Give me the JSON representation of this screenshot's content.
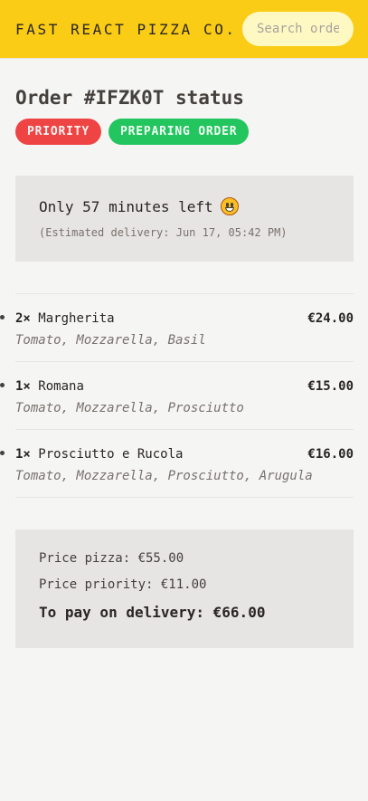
{
  "header": {
    "logo": "FAST REACT PIZZA CO.",
    "search_placeholder": "Search order #"
  },
  "order": {
    "title": "Order #IFZK0T status",
    "badges": {
      "priority": "PRIORITY",
      "status": "PREPARING ORDER"
    },
    "eta": {
      "main": "Only 57 minutes left",
      "emoji": "grinning-face-icon",
      "sub": "(Estimated delivery: Jun 17, 05:42 PM)"
    }
  },
  "items": [
    {
      "qty": "2×",
      "name": "Margherita",
      "price": "€24.00",
      "ingredients": "Tomato, Mozzarella, Basil"
    },
    {
      "qty": "1×",
      "name": "Romana",
      "price": "€15.00",
      "ingredients": "Tomato, Mozzarella, Prosciutto"
    },
    {
      "qty": "1×",
      "name": "Prosciutto e Rucola",
      "price": "€16.00",
      "ingredients": "Tomato, Mozzarella, Prosciutto, Arugula"
    }
  ],
  "summary": {
    "price_pizza": "Price pizza: €55.00",
    "price_priority": "Price priority: €11.00",
    "to_pay": "To pay on delivery: €66.00"
  },
  "colors": {
    "header": "#facc15",
    "priority": "#ef4444",
    "status": "#22c55e",
    "panel": "#e7e5e4"
  }
}
